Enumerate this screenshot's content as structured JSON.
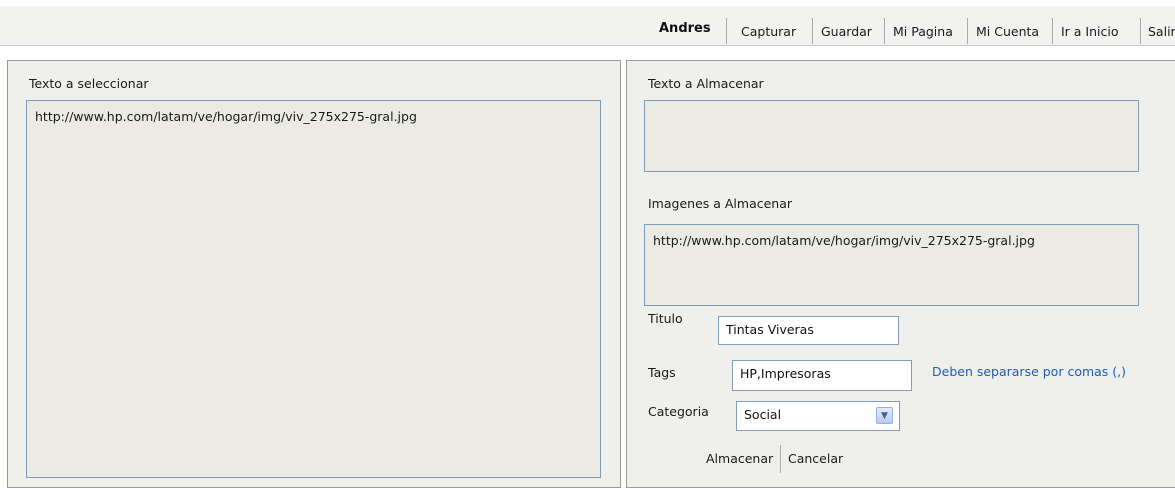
{
  "header": {
    "user": "Andres",
    "nav": [
      "Capturar",
      "Guardar",
      "Mi Pagina",
      "Mi Cuenta",
      "Ir a Inicio",
      "Salir"
    ]
  },
  "left_panel": {
    "label": "Texto a seleccionar",
    "content": "http://www.hp.com/latam/ve/hogar/img/viv_275x275-gral.jpg"
  },
  "right_panel": {
    "text_label": "Texto a Almacenar",
    "text_value": "",
    "images_label": "Imagenes a Almacenar",
    "images_value": "http://www.hp.com/latam/ve/hogar/img/viv_275x275-gral.jpg",
    "titulo_label": "Titulo",
    "titulo_value": "Tintas Viveras",
    "tags_label": "Tags",
    "tags_value": "HP,Impresoras",
    "tags_hint": "Deben separarse por comas (,)",
    "categoria_label": "Categoria",
    "categoria_value": "Social",
    "save_label": "Almacenar",
    "cancel_label": "Cancelar"
  },
  "icons": {
    "dropdown": "chevron-down-icon"
  },
  "colors": {
    "link": "#1e5fb4",
    "field_border": "#7f9db9",
    "panel_bg": "#efefeb"
  }
}
